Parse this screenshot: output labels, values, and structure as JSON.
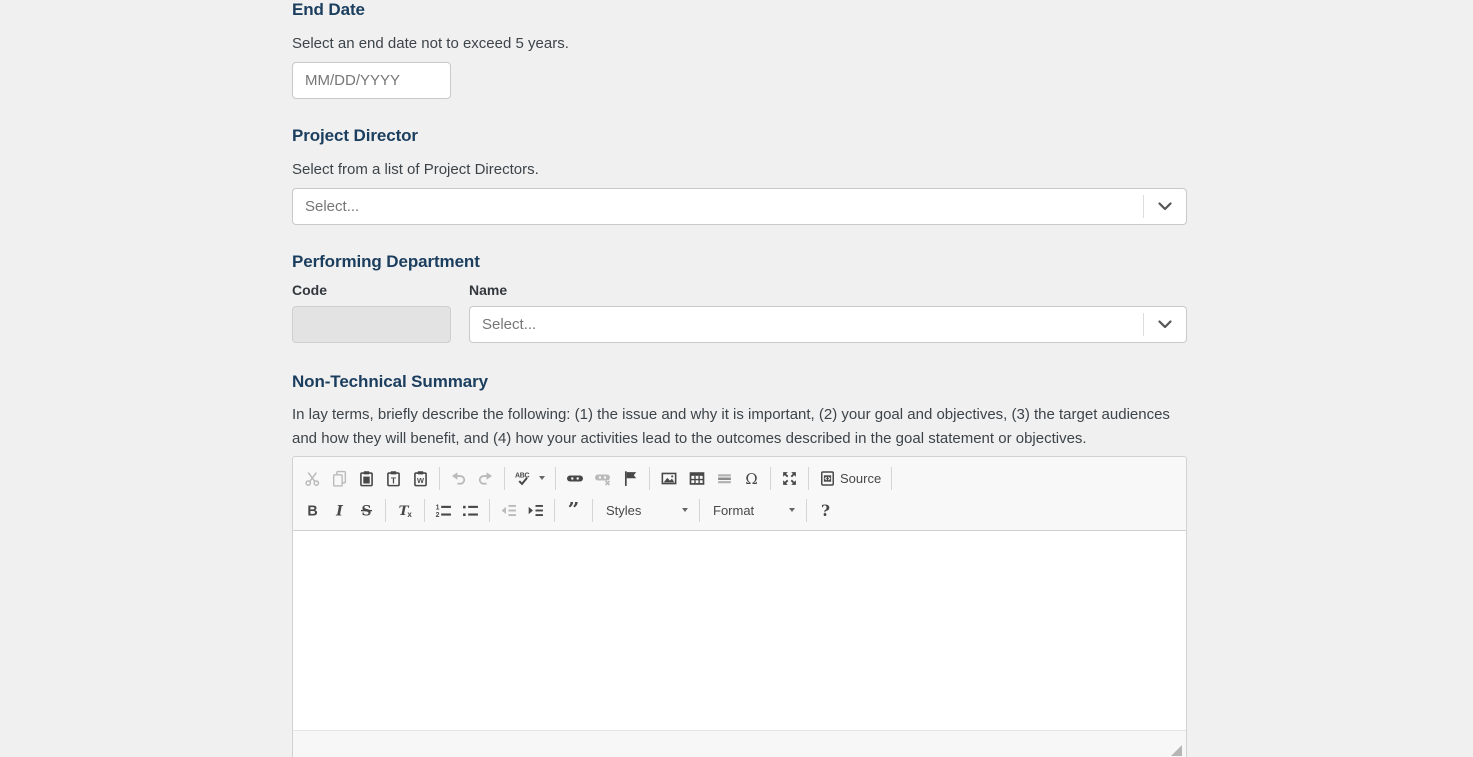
{
  "page": {
    "background": "#f0f0f0"
  },
  "colors": {
    "heading": "#1b3e5e",
    "body_text": "#3d4449",
    "placeholder": "#767676",
    "toolbar_icon": "#484848",
    "input_border": "#c9c9c9",
    "editor_border": "#d1d1d1",
    "disabled_input_bg": "#e3e3e3"
  },
  "sections": {
    "end_date": {
      "title": "End Date",
      "description": "Select an end date not to exceed 5 years.",
      "input_value": "",
      "input_placeholder": "MM/DD/YYYY"
    },
    "project_director": {
      "title": "Project Director",
      "description": "Select from a list of Project Directors.",
      "select_placeholder": "Select..."
    },
    "performing_department": {
      "title": "Performing Department",
      "code_label": "Code",
      "code_value": "",
      "name_label": "Name",
      "name_select_placeholder": "Select..."
    },
    "non_technical_summary": {
      "title": "Non-Technical Summary",
      "description": "In lay terms, briefly describe the following: (1) the issue and why it is important, (2) your goal and objectives, (3) the target audiences and how they will benefit, and (4) how your activities lead to the outcomes described in the goal statement or objectives.",
      "editor_value": ""
    }
  },
  "editor": {
    "toolbar_row1": [
      [
        {
          "name": "cut-icon",
          "disabled": true
        },
        {
          "name": "copy-icon",
          "disabled": true
        },
        {
          "name": "paste-icon"
        },
        {
          "name": "paste-text-icon"
        },
        {
          "name": "paste-word-icon"
        }
      ],
      [
        {
          "name": "undo-icon",
          "disabled": true
        },
        {
          "name": "redo-icon",
          "disabled": true
        }
      ],
      [
        {
          "name": "spellcheck-icon",
          "caret": true
        }
      ],
      [
        {
          "name": "link-icon"
        },
        {
          "name": "unlink-icon",
          "disabled": true
        },
        {
          "name": "anchor-icon"
        }
      ],
      [
        {
          "name": "image-icon"
        },
        {
          "name": "table-icon"
        },
        {
          "name": "horizontal-rule-icon"
        },
        {
          "name": "special-character-icon"
        }
      ],
      [
        {
          "name": "maximize-icon"
        }
      ],
      [
        {
          "name": "source-icon",
          "label": "Source"
        }
      ]
    ],
    "toolbar_row2": [
      [
        {
          "name": "bold-icon"
        },
        {
          "name": "italic-icon"
        },
        {
          "name": "strikethrough-icon"
        }
      ],
      [
        {
          "name": "remove-format-icon"
        }
      ],
      [
        {
          "name": "numbered-list-icon"
        },
        {
          "name": "bulleted-list-icon"
        }
      ],
      [
        {
          "name": "outdent-icon",
          "disabled": true
        },
        {
          "name": "indent-icon"
        }
      ],
      [
        {
          "name": "blockquote-icon"
        }
      ],
      [
        {
          "name": "styles-dropdown",
          "label": "Styles",
          "caret": true,
          "dropdown": true
        }
      ],
      [
        {
          "name": "format-dropdown",
          "label": "Format",
          "caret": true,
          "dropdown": true
        }
      ],
      [
        {
          "name": "help-icon"
        }
      ]
    ]
  }
}
